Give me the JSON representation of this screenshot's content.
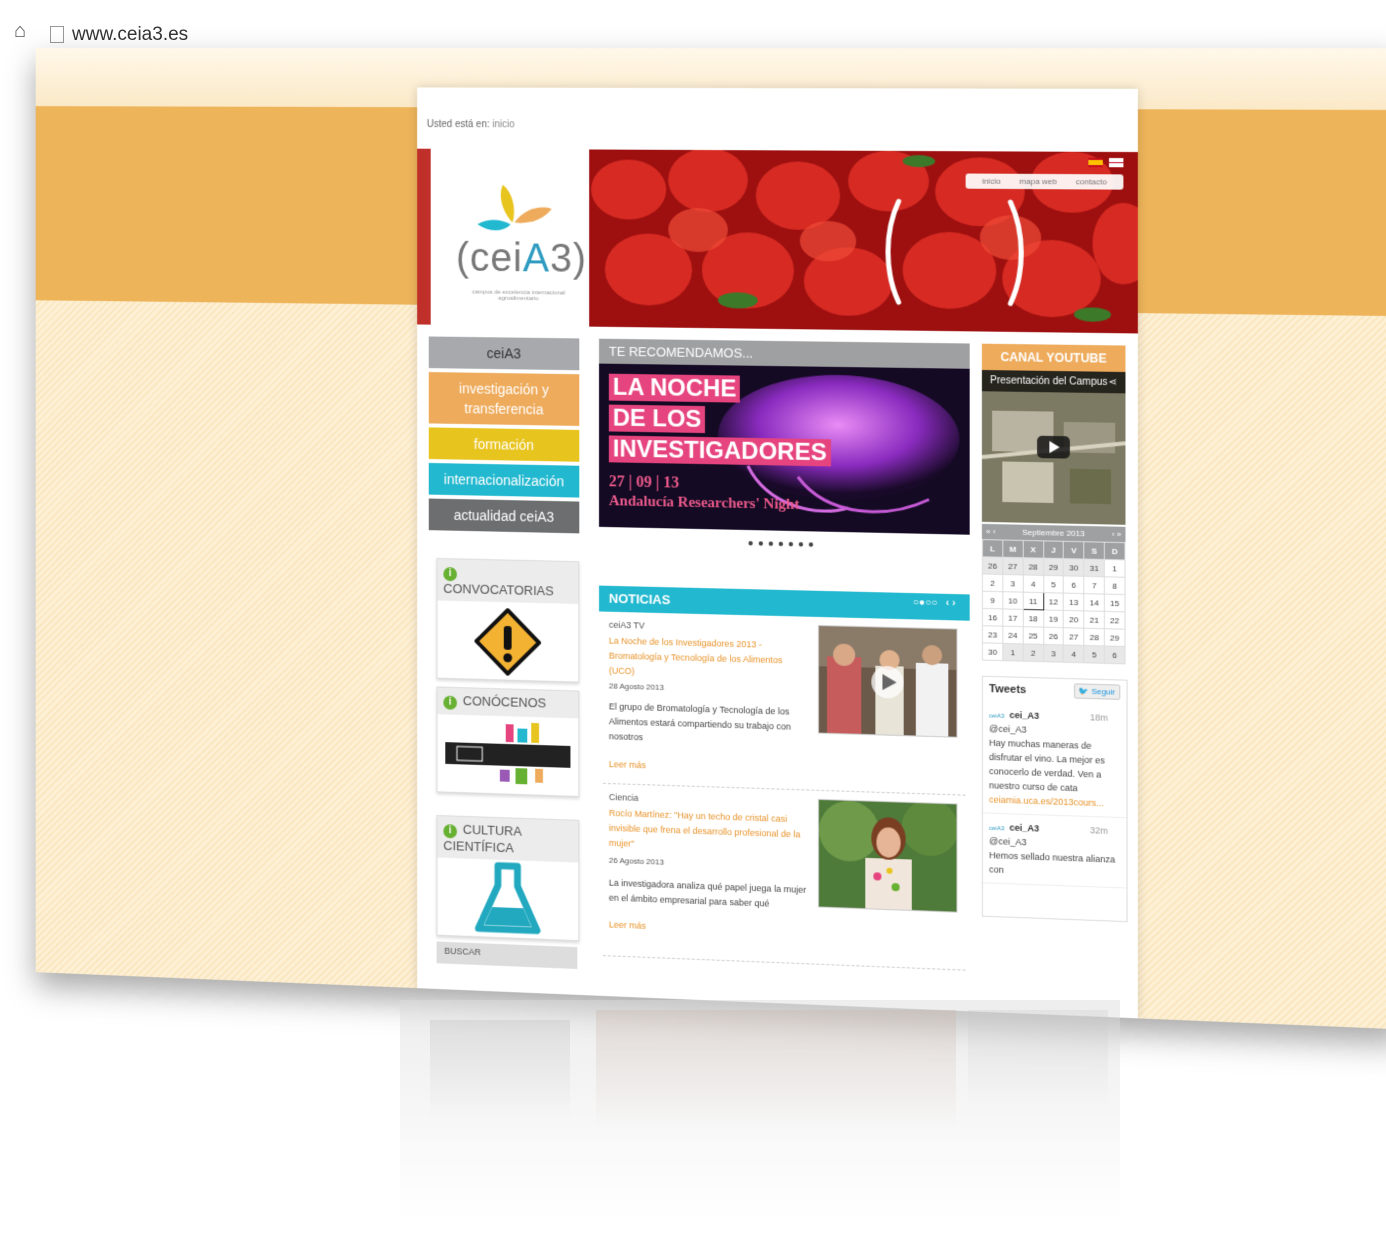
{
  "browser": {
    "url": "www.ceia3.es"
  },
  "breadcrumb": {
    "label": "Usted está en:",
    "current": "inicio"
  },
  "logo": {
    "name_prefix": "cei",
    "name_a": "A",
    "name_suffix": "3",
    "subtitle": "campus de excelencia internacional agroalimentario"
  },
  "topnav": {
    "items": [
      "inicio",
      "mapa web",
      "contacto"
    ]
  },
  "leftnav": {
    "items": [
      "ceiA3",
      "investigación y transferencia",
      "formación",
      "internacionalización",
      "actualidad ceiA3"
    ]
  },
  "widgets": {
    "convocatorias": "CONVOCATORIAS",
    "conocenos": "CONÓCENOS",
    "cultura": "CULTURA CIENTÍFICA",
    "buscar": "BUSCAR"
  },
  "recommend": {
    "header": "TE RECOMENDAMOS...",
    "line1": "LA NOCHE",
    "line2": "DE LOS",
    "line3": "INVESTIGADORES",
    "date": "27 | 09 | 13",
    "subtitle": "Andalucía Researchers' Night"
  },
  "news": {
    "header": "NOTICIAS",
    "items": [
      {
        "category": "ceiA3 TV",
        "title": "La Noche de los Investigadores 2013 - Bromatología y Tecnología de los Alimentos (UCO)",
        "date": "28 Agosto 2013",
        "desc": "El grupo de Bromatología y Tecnología de los Alimentos estará compartiendo su trabajo con nosotros",
        "more": "Leer más"
      },
      {
        "category": "Ciencia",
        "title": "Rocío Martínez: \"Hay un techo de cristal casi invisible que frena el desarrollo profesional de la mujer\"",
        "date": "26 Agosto 2013",
        "desc": "La investigadora analiza qué papel juega la mujer en el ámbito empresarial para saber qué",
        "more": "Leer más"
      }
    ]
  },
  "youtube": {
    "header": "CANAL YOUTUBE",
    "video_title": "Presentación del Campus"
  },
  "calendar": {
    "month": "Septiembre 2013",
    "days": [
      "L",
      "M",
      "X",
      "J",
      "V",
      "S",
      "D"
    ],
    "weeks": [
      [
        "26",
        "27",
        "28",
        "29",
        "30",
        "31",
        "1"
      ],
      [
        "2",
        "3",
        "4",
        "5",
        "6",
        "7",
        "8"
      ],
      [
        "9",
        "10",
        "11",
        "12",
        "13",
        "14",
        "15"
      ],
      [
        "16",
        "17",
        "18",
        "19",
        "20",
        "21",
        "22"
      ],
      [
        "23",
        "24",
        "25",
        "26",
        "27",
        "28",
        "29"
      ],
      [
        "30",
        "1",
        "2",
        "3",
        "4",
        "5",
        "6"
      ]
    ]
  },
  "tweets": {
    "header": "Tweets",
    "follow": "Seguir",
    "items": [
      {
        "name": "cei_A3",
        "handle": "@cei_A3",
        "time": "18m",
        "text": "Hay muchas maneras de disfrutar el vino. La mejor es conocerlo de verdad. Ven a nuestro curso de cata",
        "link": "ceiamia.uca.es/2013cours..."
      },
      {
        "name": "cei_A3",
        "handle": "@cei_A3",
        "time": "32m",
        "text": "Hemos sellado nuestra alianza con",
        "link": ""
      }
    ]
  },
  "colors": {
    "accent_orange": "#eeab5c",
    "accent_cyan": "#22b8cf",
    "accent_yellow": "#e8c41e",
    "gray": "#9fa0a2"
  }
}
